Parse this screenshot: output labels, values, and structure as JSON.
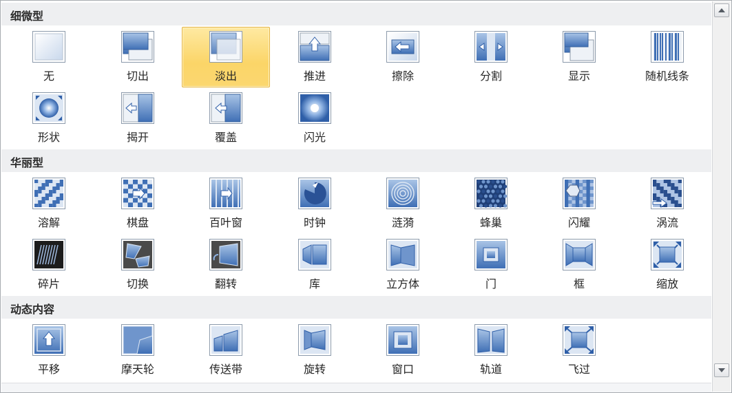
{
  "gallery": {
    "sections": [
      {
        "title": "细微型",
        "rows": [
          [
            {
              "label": "无",
              "icon": "transition-none-icon"
            },
            {
              "label": "切出",
              "icon": "transition-cut-icon"
            },
            {
              "label": "淡出",
              "icon": "transition-fade-icon",
              "selected": true
            },
            {
              "label": "推进",
              "icon": "transition-push-icon"
            },
            {
              "label": "擦除",
              "icon": "transition-wipe-icon"
            },
            {
              "label": "分割",
              "icon": "transition-split-icon"
            },
            {
              "label": "显示",
              "icon": "transition-reveal-icon"
            },
            {
              "label": "随机线条",
              "icon": "transition-random-bars-icon"
            }
          ],
          [
            {
              "label": "形状",
              "icon": "transition-shape-icon"
            },
            {
              "label": "揭开",
              "icon": "transition-uncover-icon"
            },
            {
              "label": "覆盖",
              "icon": "transition-cover-icon"
            },
            {
              "label": "闪光",
              "icon": "transition-flash-icon"
            }
          ]
        ]
      },
      {
        "title": "华丽型",
        "rows": [
          [
            {
              "label": "溶解",
              "icon": "transition-dissolve-icon"
            },
            {
              "label": "棋盘",
              "icon": "transition-checkerboard-icon"
            },
            {
              "label": "百叶窗",
              "icon": "transition-blinds-icon"
            },
            {
              "label": "时钟",
              "icon": "transition-clock-icon"
            },
            {
              "label": "涟漪",
              "icon": "transition-ripple-icon"
            },
            {
              "label": "蜂巢",
              "icon": "transition-honeycomb-icon"
            },
            {
              "label": "闪耀",
              "icon": "transition-glitter-icon"
            },
            {
              "label": "涡流",
              "icon": "transition-vortex-icon"
            }
          ],
          [
            {
              "label": "碎片",
              "icon": "transition-shred-icon"
            },
            {
              "label": "切换",
              "icon": "transition-switch-icon"
            },
            {
              "label": "翻转",
              "icon": "transition-flip-icon"
            },
            {
              "label": "库",
              "icon": "transition-gallery-icon"
            },
            {
              "label": "立方体",
              "icon": "transition-cube-icon"
            },
            {
              "label": "门",
              "icon": "transition-doors-icon"
            },
            {
              "label": "框",
              "icon": "transition-box-icon"
            },
            {
              "label": "缩放",
              "icon": "transition-zoom-icon"
            }
          ]
        ]
      },
      {
        "title": "动态内容",
        "rows": [
          [
            {
              "label": "平移",
              "icon": "transition-pan-icon"
            },
            {
              "label": "摩天轮",
              "icon": "transition-ferris-wheel-icon"
            },
            {
              "label": "传送带",
              "icon": "transition-conveyor-icon"
            },
            {
              "label": "旋转",
              "icon": "transition-rotate-icon"
            },
            {
              "label": "窗口",
              "icon": "transition-window-icon"
            },
            {
              "label": "轨道",
              "icon": "transition-orbit-icon"
            },
            {
              "label": "飞过",
              "icon": "transition-fly-through-icon"
            }
          ]
        ]
      }
    ]
  },
  "colors": {
    "accent_blue": "#4f81bd",
    "selected_fill": "#fbd568",
    "selected_border": "#e5b33e"
  }
}
